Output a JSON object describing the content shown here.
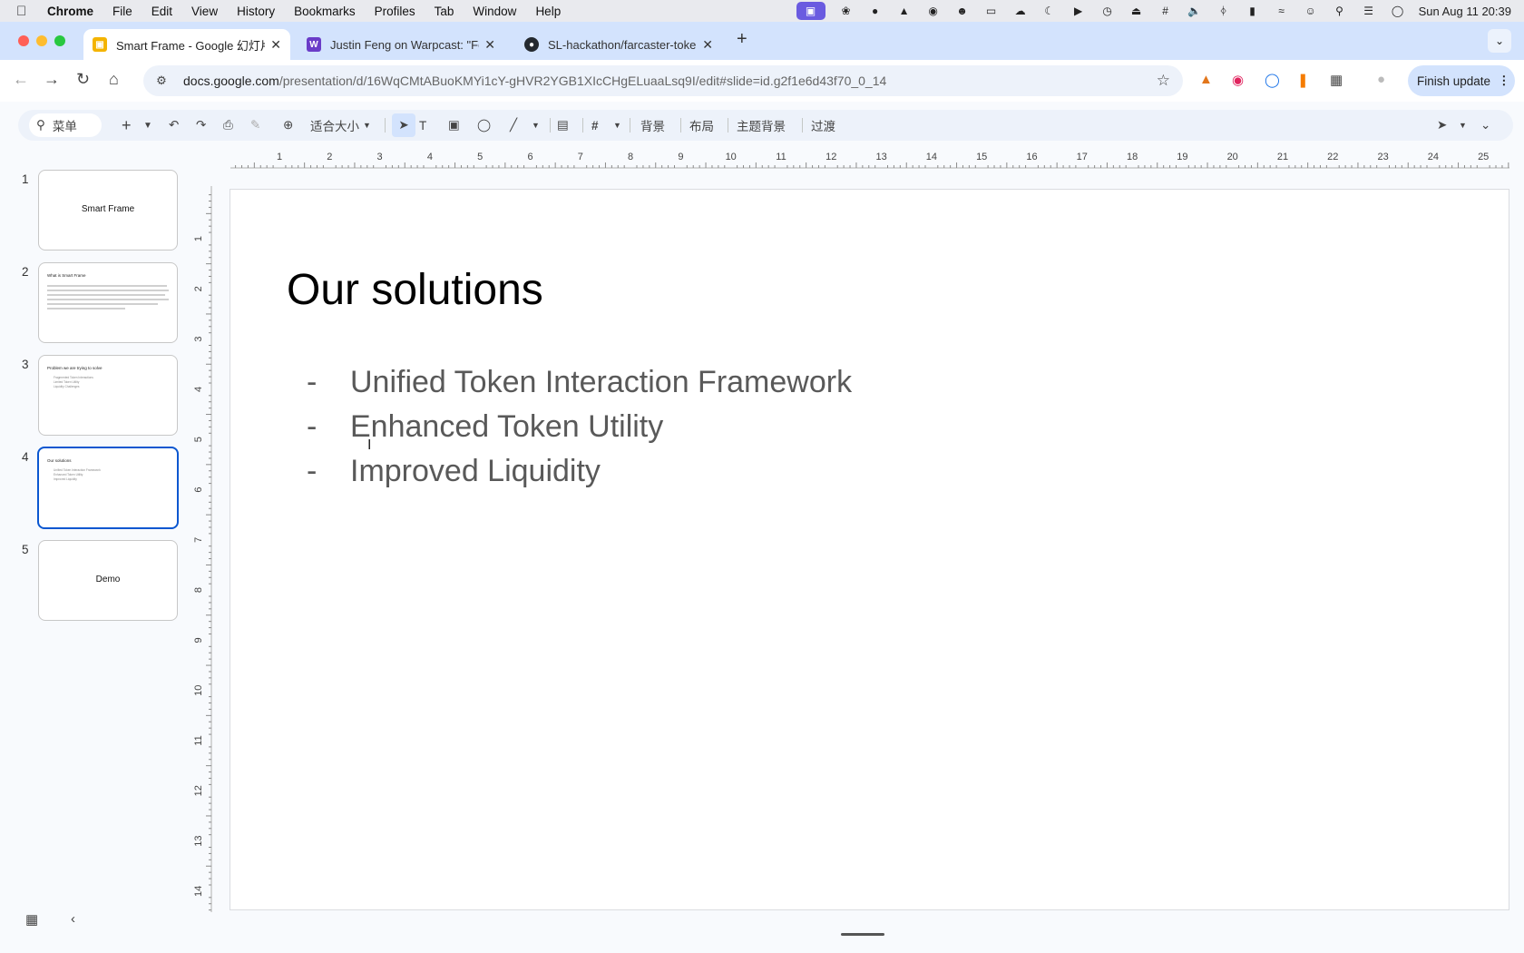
{
  "menubar": {
    "app": "Chrome",
    "items": [
      "File",
      "Edit",
      "View",
      "History",
      "Bookmarks",
      "Profiles",
      "Tab",
      "Window",
      "Help"
    ],
    "datetime": "Sun Aug 11  20:39",
    "status_icons": [
      "screen-record-icon",
      "openai-icon",
      "badge-76-icon",
      "drive-icon",
      "copilot-icon",
      "wechat-icon",
      "display-icon",
      "cloud-icon",
      "moon-icon",
      "play-icon",
      "clock-icon",
      "eject-icon",
      "hash-icon",
      "volume-icon",
      "bluetooth-icon",
      "battery-icon",
      "wifi-icon",
      "user-icon",
      "search-icon",
      "control-center-icon",
      "siri-icon"
    ]
  },
  "tabs": [
    {
      "title": "Smart Frame - Google 幻灯片",
      "favicon": "slides-favicon",
      "active": true
    },
    {
      "title": "Justin Feng on Warpcast: \"Fo",
      "favicon": "warpcast-favicon",
      "active": false
    },
    {
      "title": "SL-hackathon/farcaster-toke",
      "favicon": "github-favicon",
      "active": false
    }
  ],
  "address_bar": {
    "domain": "docs.google.com",
    "path": "/presentation/d/16WqCMtABuoKMYi1cY-gHVR2YGB1XIcCHgELuaaLsq9I/edit#slide=id.g2f1e6d43f70_0_14"
  },
  "finish_update_label": "Finish update",
  "slides_toolbar": {
    "search_label": "菜单",
    "zoom_label": "适合大小",
    "background_label": "背景",
    "layout_label": "布局",
    "theme_label": "主题背景",
    "transition_label": "过渡"
  },
  "filmstrip": [
    {
      "num": "1",
      "title": "Smart Frame"
    },
    {
      "num": "2",
      "title": "What is Smart Frame"
    },
    {
      "num": "3",
      "title": "Problem we are trying to solve",
      "items": [
        "Fragmented Token Interactions",
        "Limited Token Utility",
        "Liquidity Challenges"
      ]
    },
    {
      "num": "4",
      "title": "Our solutions",
      "items": [
        "Unified Token Interaction Framework",
        "Enhanced Token Utility",
        "Improved Liquidity"
      ]
    },
    {
      "num": "5",
      "title": "Demo"
    }
  ],
  "ruler": {
    "horizontal": [
      "1",
      "2",
      "3",
      "4",
      "5",
      "6",
      "7",
      "8",
      "9",
      "10",
      "11",
      "12",
      "13",
      "14",
      "15",
      "16",
      "17",
      "18",
      "19",
      "20",
      "21",
      "22",
      "23",
      "24",
      "25"
    ],
    "vertical": [
      "1",
      "2",
      "3",
      "4",
      "5",
      "6",
      "7",
      "8",
      "9",
      "10",
      "11",
      "12",
      "13",
      "14"
    ]
  },
  "slide": {
    "title": "Our solutions",
    "bullet_marker": "-",
    "bullets": [
      "Unified Token Interaction Framework",
      "Enhanced Token Utility",
      "Improved Liquidity"
    ]
  },
  "colors": {
    "accent": "#0b57d0",
    "tab_strip": "#d3e3fd",
    "slide_text": "#595959"
  }
}
